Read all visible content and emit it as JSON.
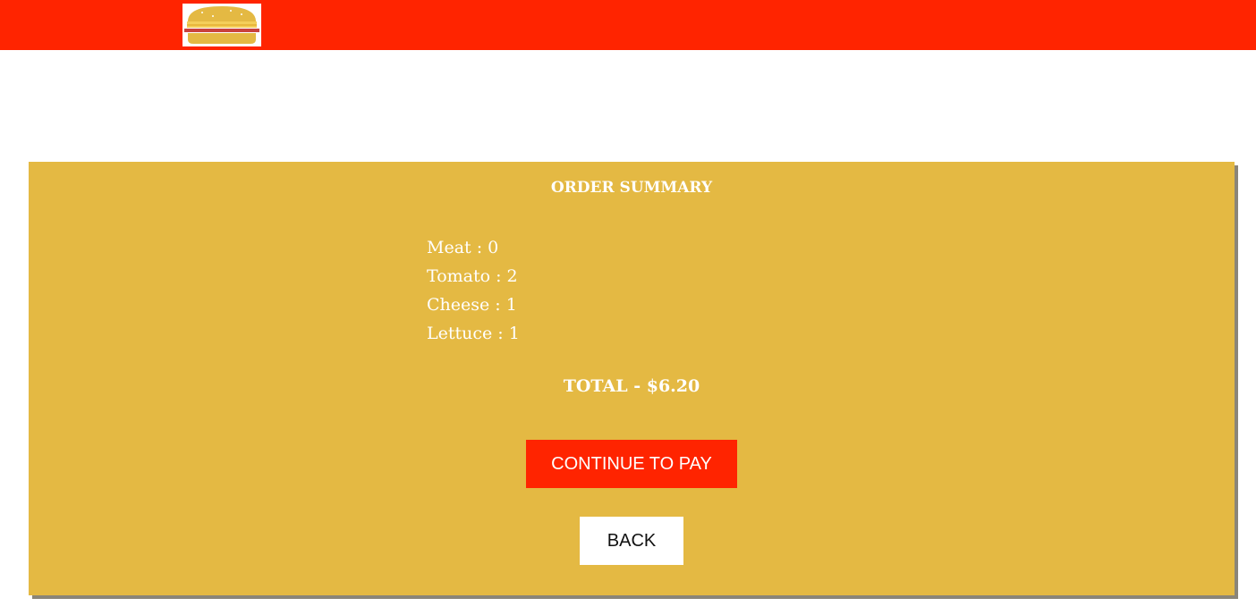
{
  "header": {
    "logo_icon": "burger-logo-icon",
    "bar_color": "#ff2400"
  },
  "order_summary": {
    "panel_color": "#e4b943",
    "title": "ORDER SUMMARY",
    "ingredients": [
      {
        "label": "Meat : 0"
      },
      {
        "label": "Tomato : 2"
      },
      {
        "label": "Cheese : 1"
      },
      {
        "label": "Lettuce : 1"
      }
    ],
    "total": "TOTAL - $6.20"
  },
  "actions": {
    "continue_label": "CONTINUE TO PAY",
    "continue_color": "#ff2400",
    "back_label": "BACK"
  }
}
